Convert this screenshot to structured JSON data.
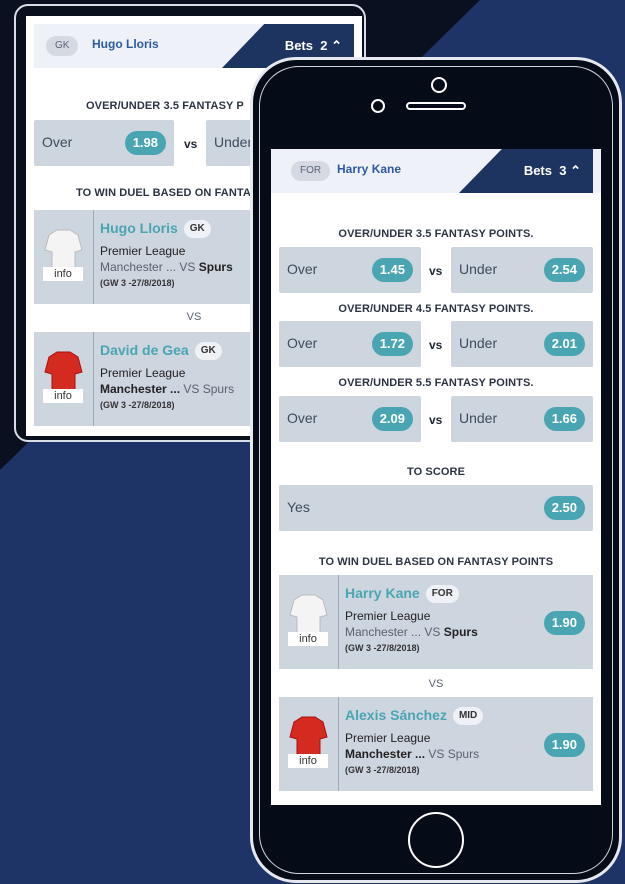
{
  "colors": {
    "accent": "#4aa5b2",
    "navy": "#1d3461",
    "background": "#1f3466"
  },
  "back_screen": {
    "position_chip": "GK",
    "player_name": "Hugo Lloris",
    "bets_label": "Bets",
    "bets_count": "2",
    "section1": "OVER/UNDER 3.5 FANTASY P",
    "over_label": "Over",
    "over_odds": "1.98",
    "vs": "vs",
    "under_label": "Under",
    "section2": "TO WIN DUEL BASED ON FANTAS",
    "duel": [
      {
        "name": "Hugo Lloris",
        "pos": "GK",
        "league": "Premier League",
        "home": "Manchester ...",
        "vs": "VS",
        "away": "Spurs",
        "gw": "(GW 3 -27/8/2018)",
        "info": "info",
        "jersey": "white"
      },
      {
        "name": "David de Gea",
        "pos": "GK",
        "league": "Premier League",
        "home": "Manchester ...",
        "vs": "VS",
        "away": "Spurs",
        "gw": "(GW 3 -27/8/2018)",
        "info": "info",
        "jersey": "red"
      }
    ],
    "vs_mid": "VS"
  },
  "front_screen": {
    "position_chip": "FOR",
    "player_name": "Harry Kane",
    "bets_label": "Bets",
    "bets_count": "3",
    "markets": [
      {
        "title": "OVER/UNDER 3.5 FANTASY POINTS.",
        "over_label": "Over",
        "over_odds": "1.45",
        "vs": "vs",
        "under_label": "Under",
        "under_odds": "2.54"
      },
      {
        "title": "OVER/UNDER 4.5 FANTASY POINTS.",
        "over_label": "Over",
        "over_odds": "1.72",
        "vs": "vs",
        "under_label": "Under",
        "under_odds": "2.01"
      },
      {
        "title": "OVER/UNDER 5.5 FANTASY POINTS.",
        "over_label": "Over",
        "over_odds": "2.09",
        "vs": "vs",
        "under_label": "Under",
        "under_odds": "1.66"
      }
    ],
    "to_score": {
      "title": "TO SCORE",
      "label": "Yes",
      "odds": "2.50"
    },
    "duel_title": "TO WIN DUEL BASED ON FANTASY POINTS",
    "duel": [
      {
        "name": "Harry Kane",
        "pos": "FOR",
        "league": "Premier League",
        "home": "Manchester ...",
        "vs": "VS",
        "away": "Spurs",
        "gw": "(GW 3 -27/8/2018)",
        "info": "info",
        "odds": "1.90",
        "jersey": "white"
      },
      {
        "name": "Alexis Sánchez",
        "pos": "MID",
        "league": "Premier League",
        "home": "Manchester ...",
        "vs": "VS",
        "away": "Spurs",
        "gw": "(GW 3 -27/8/2018)",
        "info": "info",
        "odds": "1.90",
        "jersey": "red"
      }
    ],
    "vs_mid": "VS"
  }
}
